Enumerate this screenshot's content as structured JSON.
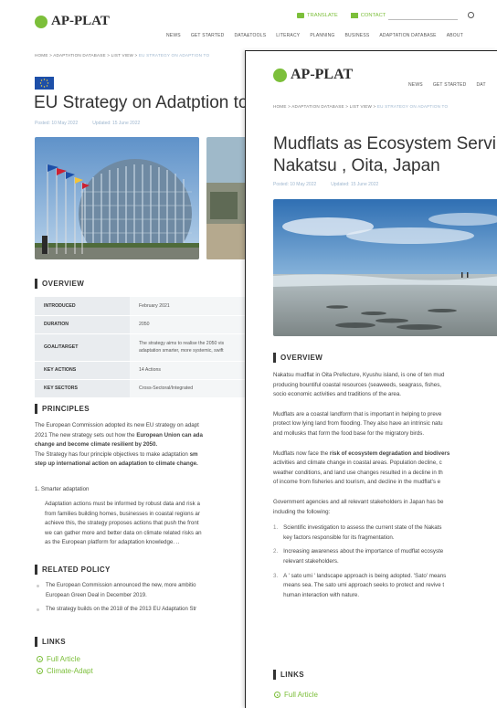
{
  "back": {
    "logo_text": "AP-PLAT",
    "top_links": {
      "translate": "TRANSLATE",
      "contact": "CONTACT"
    },
    "nav": [
      "NEWS",
      "GET STARTED",
      "DATA&TOOLS",
      "LITERACY",
      "PLANNING",
      "BUSINESS",
      "ADAPTATION DATABASE",
      "ABOUT"
    ],
    "breadcrumb": {
      "home": "HOME",
      "db": "ADAPTATION DATABASE",
      "list": "LIST VIEW",
      "current": "EU STRATEGY ON ADAPTION TO"
    },
    "title": "EU Strategy on Adatption to",
    "posted": "Posted: 10 May 2022",
    "updated": "Updated: 15 June 2022",
    "overview_heading": "OVERVIEW",
    "table": [
      {
        "key": "INTRODUCED",
        "value": "February 2021"
      },
      {
        "key": "DURATION",
        "value": "2050"
      },
      {
        "key": "GOAL/TARGET",
        "value": "The strategy aims to realise the 2050 vis",
        "value2": "adaptation smarter, more systemic, swift"
      },
      {
        "key": "KEY ACTIONS",
        "value": "14 Actions"
      },
      {
        "key": "KEY SECTORS",
        "value": "Cross-Sectoral/Integrated"
      }
    ],
    "principles_heading": "PRINCIPLES",
    "principles_lines": [
      {
        "pre": "The European Commission adopted its new EU strategy on adapt",
        "bold": ""
      },
      {
        "pre": "2021 The new strategy sets out how the ",
        "bold": "European Union can ada"
      },
      {
        "pre": "",
        "bold": "change and become climate resilient by 2050."
      },
      {
        "pre": " The Strategy has four principle objectives to make adaptation ",
        "bold": "sm"
      },
      {
        "pre": "",
        "bold": "step up international action on adaptation to climate change."
      }
    ],
    "sub_item": "1.  Smarter adaptation",
    "sub_lines": [
      "Adaptation actions must be informed by robust data and risk a",
      "from families building homes, businesses in coastal regions ar",
      "achieve this, the strategy proposes actions that push the front",
      "we can gather more and better data on climate related risks an",
      "as the European platform for adaptation knowledge. .."
    ],
    "related_heading": "RELATED POLICY",
    "related": [
      {
        "l1": "The European Commission announced the new, more ambitio",
        "l2": "European Green Deal in December 2019."
      },
      {
        "l1": "The strategy builds on the 2018 of the 2013 EU Adaptation Str",
        "l2": ""
      }
    ],
    "links_heading": "LINKS",
    "links": [
      "Full Article",
      "Climate-Adapt"
    ]
  },
  "front": {
    "logo_text": "AP-PLAT",
    "nav": [
      "NEWS",
      "GET STARTED",
      "DAT"
    ],
    "breadcrumb": {
      "home": "HOME",
      "db": "ADAPTATION DATABASE",
      "list": "LIST VIEW",
      "current": "EU STRATEGY ON ADAPTION TO"
    },
    "title_line1": "Mudflats as Ecosystem Servi",
    "title_line2": "Nakatsu , Oita, Japan",
    "posted": "Posted: 10 May 2022",
    "updated": "Updated: 15 June 2022",
    "overview_heading": "OVERVIEW",
    "p1": [
      "Nakatsu mudflat in Oita Prefecture, Kyushu island, is one of ten mud",
      "producing bountiful coastal resources (seaweeds, seagrass, fishes,",
      "socio economic activities and traditions of the area."
    ],
    "p2": [
      "Mudflats are a coastal landform that is important in helping to preve",
      "protect low lying land from flooding. They also have an intrinsic natu",
      "and mollusks that form the food base for the migratory birds."
    ],
    "p3": [
      {
        "pre": "Mudflats now face the ",
        "bold": "risk of ecosystem degradation and biodivers"
      },
      {
        "pre": "activities and climate change in coastal areas. Population decline, c",
        "bold": ""
      },
      {
        "pre": "weather conditions, and land use changes resulted in a decline in th",
        "bold": ""
      },
      {
        "pre": "of income from fisheries and tourism, and decline in the mudflat's e",
        "bold": ""
      }
    ],
    "p4": [
      "Government agencies and all relevant stakeholders in Japan has be",
      "including the following:"
    ],
    "items": [
      {
        "n": "1.",
        "l1": "Scientific investigation to assess the current state of the Nakats",
        "l2": "key factors responsible for its fragmentation."
      },
      {
        "n": "2.",
        "l1": "Increasing awareness about the importance of mudflat ecosyste",
        "l2": "relevant stakeholders."
      },
      {
        "n": "3.",
        "l1": "A ' sato umi ' landscape approach is being adopted. 'Sato' means",
        "l2": "means sea. The sato umi approach seeks to protect and revive t",
        "l3": "human interaction with nature."
      }
    ],
    "links_heading": "LINKS",
    "links": [
      "Full Article"
    ]
  }
}
